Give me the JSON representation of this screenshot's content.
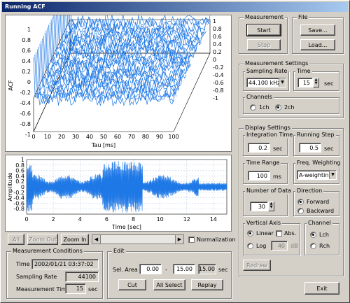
{
  "window": {
    "title": "Running ACF"
  },
  "acf_plot": {
    "ylabel": "ACF",
    "xlabel": "Tau [ms]",
    "x_ticks": [
      "0",
      "10",
      "20",
      "30",
      "40",
      "50",
      "60",
      "70",
      "80",
      "90",
      "100"
    ],
    "left_ticks": [
      "1",
      "0.8",
      "0.6",
      "0.4",
      "0.2",
      "0",
      "-0.2",
      "-0.4",
      "-0.6",
      "-0.8",
      "-1"
    ],
    "back_ticks": [
      "1",
      "0.8",
      "0.6",
      "0.4",
      "0.2",
      "0",
      "-0.2",
      "-0.4",
      "-0.6",
      "-0.8",
      "-1"
    ],
    "line_color": "#1e78e6"
  },
  "amp_plot": {
    "ylabel": "Amplitude",
    "xlabel": "Time [sec]",
    "y_ticks": [
      "1",
      "0.8",
      "0.6",
      "0.4",
      "0.2",
      "0",
      "-0.2",
      "-0.4",
      "-0.6",
      "-0.8"
    ],
    "x_ticks": [
      "0",
      "2",
      "4",
      "6",
      "8",
      "10",
      "12",
      "14"
    ],
    "wave_color": "#1e78e6"
  },
  "zoom_bar": {
    "all_label": "All",
    "zoom_out_label": "Zoom Out",
    "zoom_in_label": "Zoom In",
    "normalization_label": "Normalization"
  },
  "measurement_conditions": {
    "title": "Measurement Conditions",
    "time_label": "Time",
    "time_value": "2002/01/21 03:37:02",
    "sampling_rate_label": "Sampling Rate",
    "sampling_rate_value": "44100",
    "measurement_time_label": "Measurement Time",
    "measurement_time_value": "15",
    "measurement_time_unit": "sec"
  },
  "edit": {
    "title": "Edit",
    "sel_area_label": "Sel. Area",
    "start_value": "0.00",
    "dash": "-",
    "end_value": "15.00",
    "total_value": "15.00",
    "unit": "sec",
    "cut_label": "Cut",
    "all_select_label": "All Select",
    "replay_label": "Replay"
  },
  "measurement": {
    "title": "Measurement",
    "start_label": "Start",
    "stop_label": "Stop"
  },
  "file": {
    "title": "File",
    "save_label": "Save...",
    "load_label": "Load..."
  },
  "measurement_settings": {
    "title": "Measurement Settings",
    "sampling_rate_title": "Sampling Rate",
    "sampling_rate_value": "44.100 kHz",
    "time_title": "Time",
    "time_value": "15",
    "time_unit": "sec",
    "channels_title": "Channels",
    "ch1_label": "1ch",
    "ch2_label": "2ch"
  },
  "display_settings": {
    "title": "Display Settings",
    "integration_time_title": "Integration Time",
    "integration_time_value": "0.2",
    "integration_time_unit": "sec",
    "running_step_title": "Running Step",
    "running_step_value": "0.5",
    "running_step_unit": "sec",
    "time_range_title": "Time Range",
    "time_range_value": "100",
    "time_range_unit": "ms",
    "freq_weighting_title": "Freq. Weighting",
    "freq_weighting_value": "A-weighting",
    "number_of_data_title": "Number of Data",
    "number_of_data_value": "30",
    "direction_title": "Direction",
    "forward_label": "Forward",
    "backward_label": "Backward",
    "vertical_axis_title": "Vertical Axis",
    "linear_label": "Linear",
    "abs_label": "Abs.",
    "log_label": "Log",
    "log_value": "40",
    "log_unit": "dB",
    "channel_title": "Channel",
    "lch_label": "Lch",
    "rch_label": "Rch",
    "redraw_label": "Redraw"
  },
  "exit_label": "Exit"
}
